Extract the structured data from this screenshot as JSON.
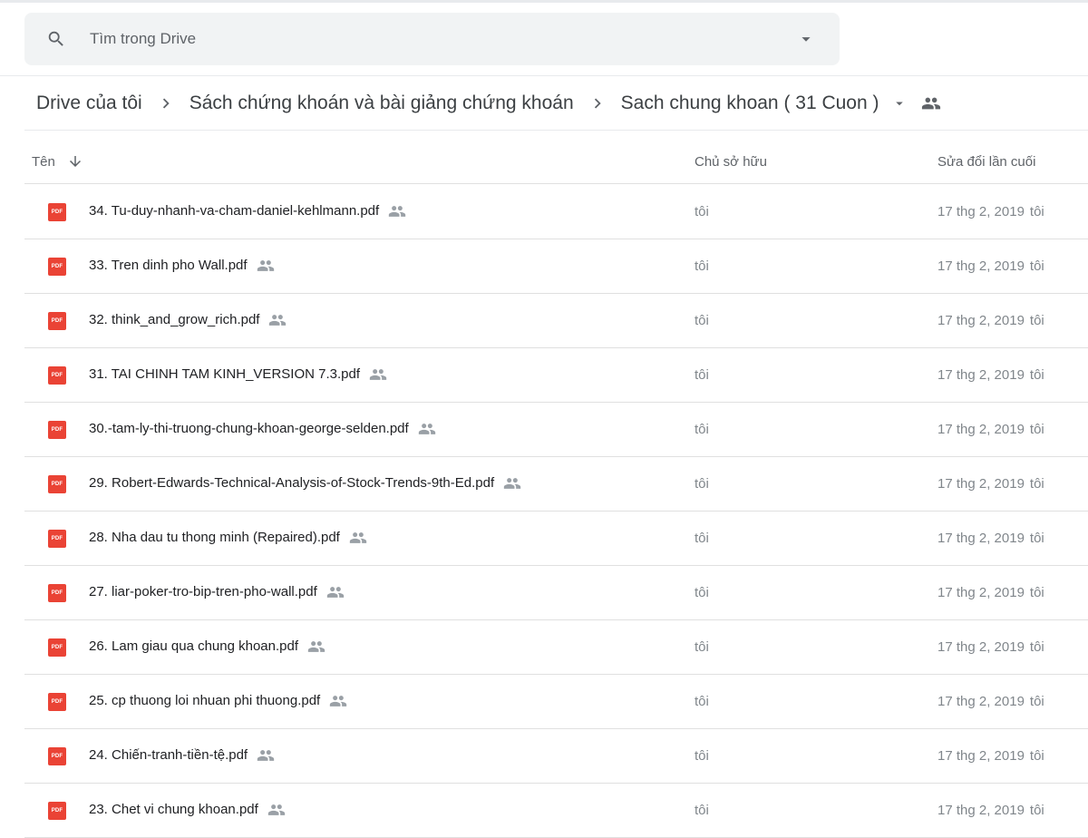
{
  "search": {
    "placeholder": "Tìm trong Drive"
  },
  "icons": {
    "search": "search-icon",
    "options": "arrow-drop-down-icon",
    "separator": "chevron-right-icon",
    "shared": "people-icon",
    "sort": "arrow-down-icon",
    "file": "pdf-icon"
  },
  "colors": {
    "pdf": "#ea4335",
    "search_bg": "#f1f3f4",
    "text_secondary": "#80868b"
  },
  "breadcrumb": [
    "Drive của tôi",
    "Sách chứng khoán và bài giảng chứng khoán",
    "Sach chung khoan ( 31 Cuon )"
  ],
  "columns": {
    "name": "Tên",
    "owner": "Chủ sở hữu",
    "modified": "Sửa đổi lần cuối"
  },
  "pdf_badge": "PDF",
  "files": [
    {
      "name": "34. Tu-duy-nhanh-va-cham-daniel-kehlmann.pdf",
      "owner": "tôi",
      "modified": "17 thg 2, 2019",
      "modified_by": "tôi"
    },
    {
      "name": "33. Tren dinh pho Wall.pdf",
      "owner": "tôi",
      "modified": "17 thg 2, 2019",
      "modified_by": "tôi"
    },
    {
      "name": "32. think_and_grow_rich.pdf",
      "owner": "tôi",
      "modified": "17 thg 2, 2019",
      "modified_by": "tôi"
    },
    {
      "name": "31. TAI CHINH TAM KINH_VERSION 7.3.pdf",
      "owner": "tôi",
      "modified": "17 thg 2, 2019",
      "modified_by": "tôi"
    },
    {
      "name": "30.-tam-ly-thi-truong-chung-khoan-george-selden.pdf",
      "owner": "tôi",
      "modified": "17 thg 2, 2019",
      "modified_by": "tôi"
    },
    {
      "name": "29. Robert-Edwards-Technical-Analysis-of-Stock-Trends-9th-Ed.pdf",
      "owner": "tôi",
      "modified": "17 thg 2, 2019",
      "modified_by": "tôi"
    },
    {
      "name": "28. Nha dau tu thong minh (Repaired).pdf",
      "owner": "tôi",
      "modified": "17 thg 2, 2019",
      "modified_by": "tôi"
    },
    {
      "name": "27. liar-poker-tro-bip-tren-pho-wall.pdf",
      "owner": "tôi",
      "modified": "17 thg 2, 2019",
      "modified_by": "tôi"
    },
    {
      "name": "26. Lam giau qua chung khoan.pdf",
      "owner": "tôi",
      "modified": "17 thg 2, 2019",
      "modified_by": "tôi"
    },
    {
      "name": "25. cp thuong loi nhuan phi thuong.pdf",
      "owner": "tôi",
      "modified": "17 thg 2, 2019",
      "modified_by": "tôi"
    },
    {
      "name": "24. Chiến-tranh-tiền-tệ.pdf",
      "owner": "tôi",
      "modified": "17 thg 2, 2019",
      "modified_by": "tôi"
    },
    {
      "name": "23. Chet vi chung khoan.pdf",
      "owner": "tôi",
      "modified": "17 thg 2, 2019",
      "modified_by": "tôi"
    }
  ]
}
